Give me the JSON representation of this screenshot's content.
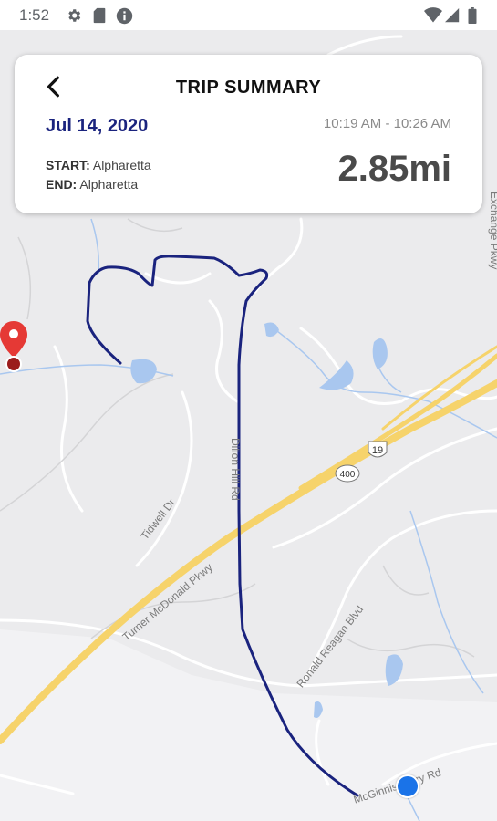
{
  "status_bar": {
    "time": "1:52",
    "left_icons": [
      "settings-icon",
      "sd-card-icon",
      "info-icon"
    ],
    "right_icons": [
      "wifi-icon",
      "signal-icon",
      "battery-icon"
    ]
  },
  "trip": {
    "title": "TRIP SUMMARY",
    "back_icon": "back-arrow-icon",
    "date": "Jul 14, 2020",
    "time_range": "10:19 AM - 10:26 AM",
    "start_label": "START:",
    "start_value": "Alpharetta",
    "end_label": "END:",
    "end_value": "Alpharetta",
    "distance": "2.85mi"
  },
  "map": {
    "labels": {
      "tidwell": "Tidwell Dr",
      "turner": "Turner McDonald Pkwy",
      "ronald": "Ronald Reagan Blvd",
      "mcginnis": "McGinnis Ferry Rd",
      "dillon": "Dillon Hill Rd",
      "parkway": "Exchange Pkwy",
      "us19": "19",
      "ga400": "400"
    },
    "route_color": "#1a237e",
    "highway_color": "#f6d36b",
    "start_marker_color": "#e53935",
    "current_location_color": "#1a73e8"
  }
}
